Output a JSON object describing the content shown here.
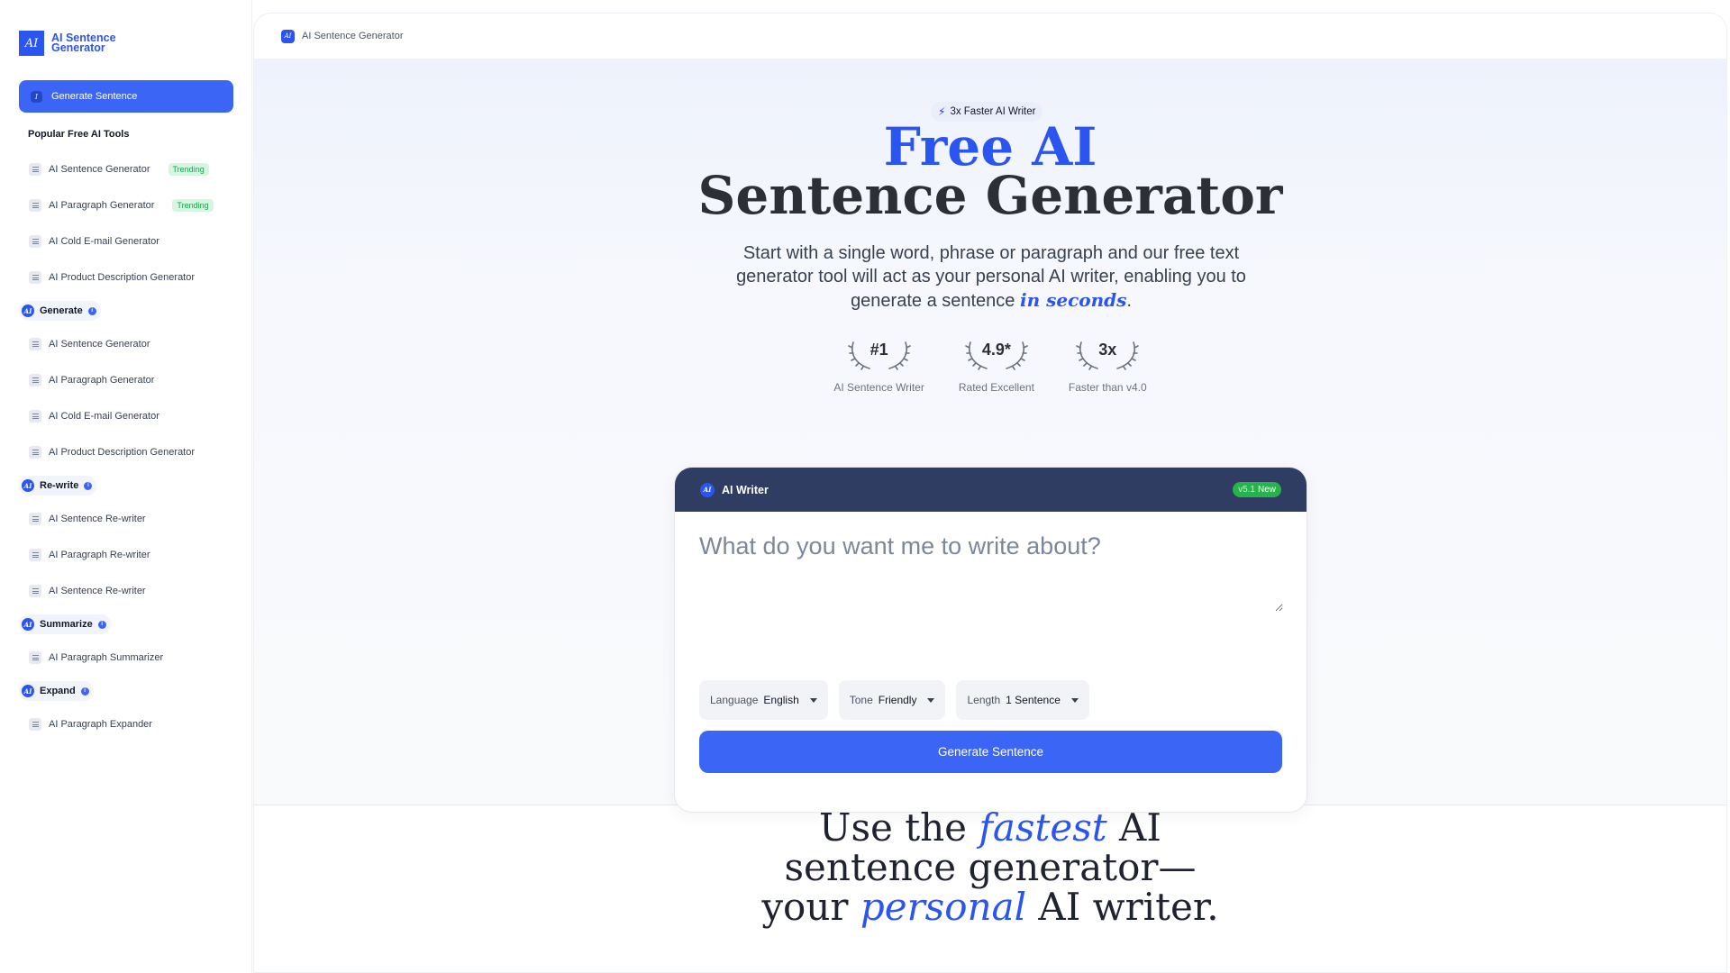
{
  "brand": {
    "logo": "AI",
    "name": "AI Sentence Generator"
  },
  "sidebar": {
    "primary_button": {
      "icon": "I",
      "label": "Generate Sentence"
    },
    "popular": {
      "heading": "Popular Free AI Tools",
      "items": [
        {
          "label": "AI Sentence Generator",
          "badge": "Trending"
        },
        {
          "label": "AI Paragraph Generator",
          "badge": "Trending"
        },
        {
          "label": "AI Cold E-mail Generator"
        },
        {
          "label": "AI Product Description Generator"
        }
      ]
    },
    "groups": [
      {
        "title": "Generate",
        "items": [
          "AI Sentence Generator",
          "AI Paragraph Generator",
          "AI Cold E-mail Generator",
          "AI Product Description Generator"
        ]
      },
      {
        "title": "Re-write",
        "items": [
          "AI Sentence Re-writer",
          "AI Paragraph Re-writer",
          "AI Sentence Re-writer"
        ]
      },
      {
        "title": "Summarize",
        "items": [
          "AI Paragraph Summarizer"
        ]
      },
      {
        "title": "Expand",
        "items": [
          "AI Paragraph Expander"
        ]
      }
    ]
  },
  "topbar": {
    "breadcrumb": "AI Sentence Generator"
  },
  "hero": {
    "pill": "3x Faster AI Writer",
    "title_line1": "Free AI",
    "title_line2": "Sentence Generator",
    "subtitle_pre": "Start with a single word, phrase or paragraph and our free text generator tool will act as your personal AI writer, enabling you to generate a sentence ",
    "subtitle_accent": "in seconds",
    "subtitle_post": ".",
    "stats": [
      {
        "value": "#1",
        "label": "AI Sentence Writer"
      },
      {
        "value": "4.9*",
        "label": "Rated Excellent"
      },
      {
        "value": "3x",
        "label": "Faster than v4.0"
      }
    ]
  },
  "writer": {
    "header_title": "AI Writer",
    "version": "v5.1",
    "version_badge": "New",
    "prompt_placeholder": "What do you want me to write about?",
    "controls": {
      "language": {
        "label": "Language",
        "value": "English"
      },
      "tone": {
        "label": "Tone",
        "value": "Friendly"
      },
      "length": {
        "label": "Length",
        "value": "1 Sentence"
      }
    },
    "generate_button": "Generate Sentence"
  },
  "lower": {
    "line1_pre": "Use the ",
    "line1_em": "fastest",
    "line1_post": " AI",
    "line2": "sentence generator—",
    "line3_pre": "your ",
    "line3_em": "personal",
    "line3_post": " AI writer."
  },
  "colors": {
    "accent": "#2b55f0",
    "button": "#3b66f5",
    "card_header": "#2f3d63",
    "trending": "#16a34a",
    "new_badge": "#27b34b"
  }
}
